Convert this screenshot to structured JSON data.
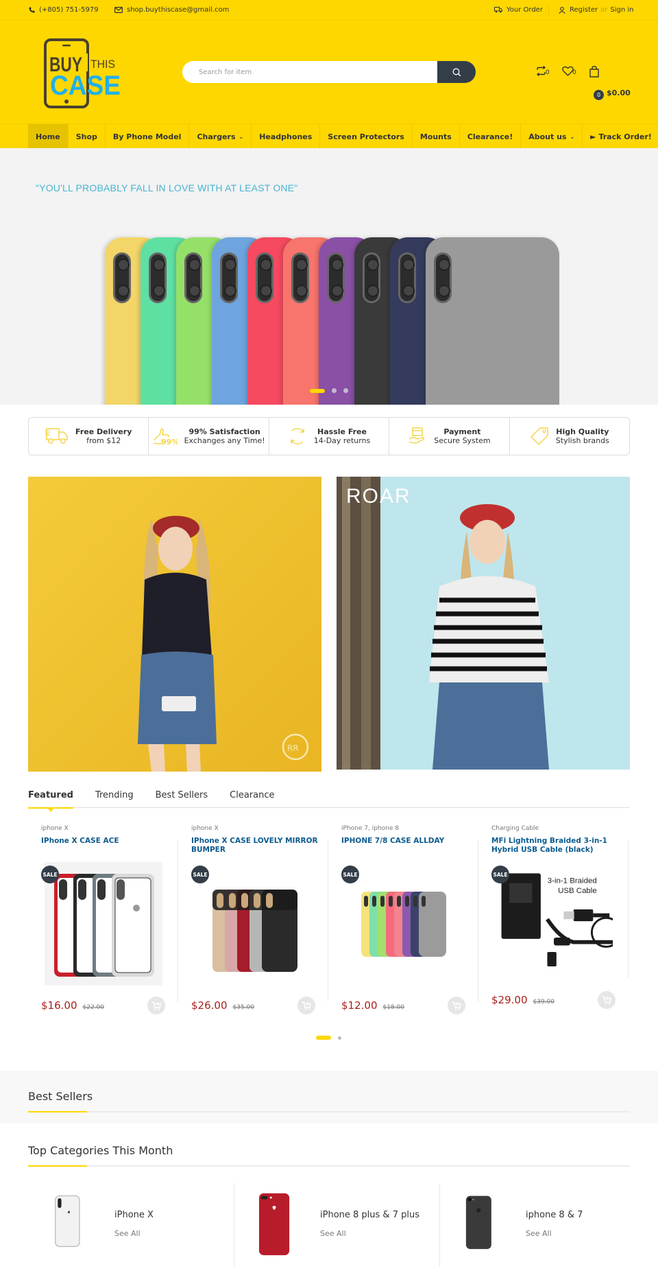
{
  "topbar": {
    "phone": "(+805) 751-5979",
    "email": "shop.buythiscase@gmail.com",
    "your_order": "Your Order",
    "register": "Register",
    "or": "or",
    "sign_in": "Sign in"
  },
  "header": {
    "logo_line1": "BUY",
    "logo_line1b": "THIS",
    "logo_line2": "CASE",
    "search_placeholder": "Search for item",
    "compare_count": "0",
    "wishlist_count": "0",
    "cart_count": "0",
    "cart_total": "$0.00"
  },
  "nav": {
    "items": [
      {
        "label": "Home",
        "active": true
      },
      {
        "label": "Shop"
      },
      {
        "label": "By Phone Model"
      },
      {
        "label": "Chargers",
        "dropdown": true
      },
      {
        "label": "Headphones"
      },
      {
        "label": "Screen Protectors"
      },
      {
        "label": "Mounts"
      },
      {
        "label": "Clearance!"
      },
      {
        "label": "About us",
        "dropdown": true
      },
      {
        "label": "► Track Order!"
      }
    ]
  },
  "hero": {
    "tagline": "\"YOU'LL PROBABLY FALL IN LOVE WITH AT LEAST ONE\"",
    "slides": 3,
    "active_slide": 1,
    "case_colors": [
      "#f3d568",
      "#5fe0a3",
      "#95e069",
      "#6fa5de",
      "#f54a60",
      "#f7756c",
      "#8a50a6",
      "#3a3a3a",
      "#353b5c",
      "#9a9a9a"
    ]
  },
  "features": [
    {
      "title": "Free Delivery",
      "sub": "from $12",
      "icon": "truck-icon"
    },
    {
      "title": "99% Satisfaction",
      "sub": "Exchanges any Time!",
      "icon": "thumbs-up-icon"
    },
    {
      "title": "Hassle Free",
      "sub": "14-Day returns",
      "icon": "refresh-icon"
    },
    {
      "title": "Payment",
      "sub": "Secure System",
      "icon": "payment-hand-icon"
    },
    {
      "title": "High Quality",
      "sub": "Stylish brands",
      "icon": "tag-icon"
    }
  ],
  "banners": {
    "banner2_brand": "ROAR"
  },
  "tabs": [
    {
      "label": "Featured",
      "active": true
    },
    {
      "label": "Trending"
    },
    {
      "label": "Best Sellers"
    },
    {
      "label": "Clearance"
    }
  ],
  "products": [
    {
      "category": "iphone X",
      "name": "IPhone X CASE ACE",
      "badge": "SALE",
      "price": "$16.00",
      "old_price": "$22.00"
    },
    {
      "category": "iphone X",
      "name": "IPhone X CASE LOVELY MIRROR BUMPER",
      "badge": "SALE",
      "price": "$26.00",
      "old_price": "$35.00"
    },
    {
      "category": "iPhone 7, iphone 8",
      "name": "IPHONE 7/8 CASE ALLDAY",
      "badge": "SALE",
      "price": "$12.00",
      "old_price": "$18.00"
    },
    {
      "category": "Charging Cable",
      "name": "MFi Lightning Braided 3-in-1 Hybrid USB Cable (black)",
      "badge": "SALE",
      "price": "$29.00",
      "old_price": "$39.00",
      "image_text1": "3-in-1 Braided",
      "image_text2": "USB Cable"
    }
  ],
  "product_pages": 2,
  "product_active_page": 1,
  "best_sellers": {
    "title": "Best Sellers"
  },
  "top_categories": {
    "title": "Top Categories This Month",
    "items": [
      {
        "name": "iPhone X",
        "link": "See All"
      },
      {
        "name": "iPhone 8 plus & 7 plus",
        "link": "See All"
      },
      {
        "name": "iphone 8 & 7",
        "link": "See All"
      }
    ]
  },
  "colors": {
    "brand_yellow": "#fed700",
    "dark": "#333e48",
    "price_red": "#a8201a",
    "product_link": "#0b5b8f",
    "logo_blue": "#22b0e6"
  }
}
